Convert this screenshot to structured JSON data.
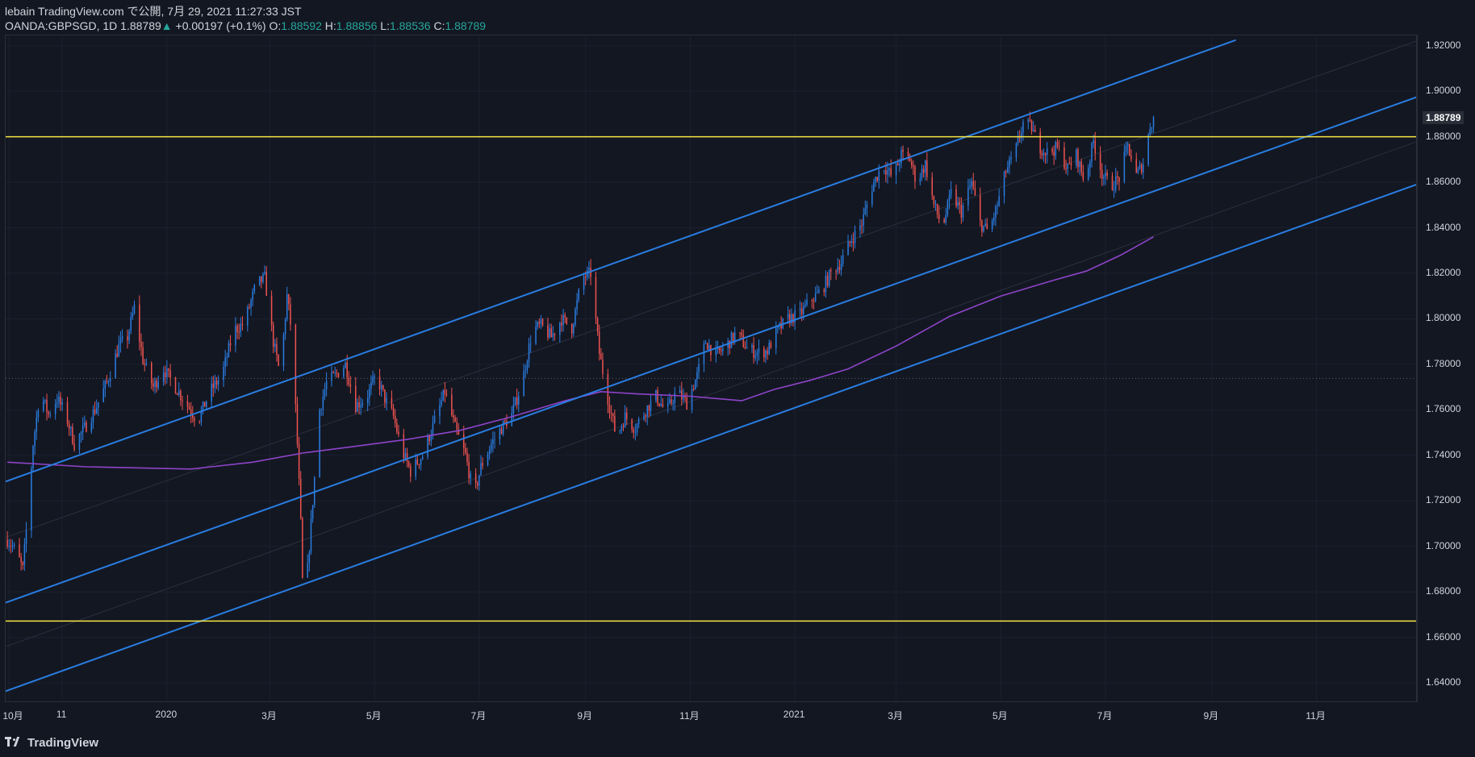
{
  "header": {
    "line1": "lebain TradingView.com で公開, 7月 29, 2021 11:27:33 JST",
    "symbol": "OANDA:GBPSGD, 1D",
    "last": "1.88789",
    "arrow": "▲",
    "change": "+0.00197 (+0.1%)",
    "o_label": "O:",
    "o_value": "1.88592",
    "h_label": "H:",
    "h_value": "1.88856",
    "l_label": "L:",
    "l_value": "1.88536",
    "c_label": "C:",
    "c_value": "1.88789"
  },
  "footer": {
    "brand": "TradingView"
  },
  "colors": {
    "bg": "#131722",
    "up": "#2a7de1",
    "down": "#ef5350",
    "channel": "#2a7de1",
    "hline": "#f5e642",
    "ma": "#8e44c9"
  },
  "chart_data": {
    "type": "candlestick",
    "symbol": "OANDA:GBPSGD",
    "timeframe": "1D",
    "y_ticks": [
      "1.92000",
      "1.90000",
      "1.88000",
      "1.86000",
      "1.84000",
      "1.82000",
      "1.80000",
      "1.78000",
      "1.76000",
      "1.74000",
      "1.72000",
      "1.70000",
      "1.68000",
      "1.66000",
      "1.64000"
    ],
    "y_tick_values": [
      1.92,
      1.9,
      1.88,
      1.86,
      1.84,
      1.82,
      1.8,
      1.78,
      1.76,
      1.74,
      1.72,
      1.7,
      1.68,
      1.66,
      1.64
    ],
    "ylim": [
      1.6312,
      1.9245
    ],
    "last_price_label": "1.88789",
    "last_price": 1.88789,
    "x_ticks": [
      {
        "label": "10月",
        "date": "2019-10-01"
      },
      {
        "label": "11",
        "date": "2019-11-01"
      },
      {
        "label": "2020",
        "date": "2020-01-01"
      },
      {
        "label": "3月",
        "date": "2020-03-01"
      },
      {
        "label": "5月",
        "date": "2020-05-01"
      },
      {
        "label": "7月",
        "date": "2020-07-01"
      },
      {
        "label": "9月",
        "date": "2020-09-01"
      },
      {
        "label": "11月",
        "date": "2020-11-01"
      },
      {
        "label": "2021",
        "date": "2021-01-01"
      },
      {
        "label": "3月",
        "date": "2021-03-01"
      },
      {
        "label": "5月",
        "date": "2021-05-01"
      },
      {
        "label": "7月",
        "date": "2021-07-01"
      },
      {
        "label": "9月",
        "date": "2021-09-01"
      },
      {
        "label": "11月",
        "date": "2021-11-01"
      }
    ],
    "xlim": [
      "2019-09-29",
      "2021-12-30"
    ],
    "price_path": [
      [
        "2019-09-30",
        1.703
      ],
      [
        "2019-10-05",
        1.698
      ],
      [
        "2019-10-09",
        1.69
      ],
      [
        "2019-10-12",
        1.715
      ],
      [
        "2019-10-15",
        1.745
      ],
      [
        "2019-10-19",
        1.768
      ],
      [
        "2019-10-24",
        1.758
      ],
      [
        "2019-10-29",
        1.765
      ],
      [
        "2019-11-03",
        1.758
      ],
      [
        "2019-11-08",
        1.745
      ],
      [
        "2019-11-14",
        1.752
      ],
      [
        "2019-11-20",
        1.76
      ],
      [
        "2019-11-27",
        1.772
      ],
      [
        "2019-12-04",
        1.788
      ],
      [
        "2019-12-09",
        1.792
      ],
      [
        "2019-12-13",
        1.805
      ],
      [
        "2019-12-18",
        1.782
      ],
      [
        "2019-12-24",
        1.77
      ],
      [
        "2019-12-30",
        1.778
      ],
      [
        "2020-01-06",
        1.77
      ],
      [
        "2020-01-13",
        1.762
      ],
      [
        "2020-01-19",
        1.755
      ],
      [
        "2020-01-26",
        1.768
      ],
      [
        "2020-02-02",
        1.775
      ],
      [
        "2020-02-09",
        1.795
      ],
      [
        "2020-02-15",
        1.798
      ],
      [
        "2020-02-22",
        1.815
      ],
      [
        "2020-02-27",
        1.818
      ],
      [
        "2020-03-03",
        1.79
      ],
      [
        "2020-03-07",
        1.775
      ],
      [
        "2020-03-11",
        1.81
      ],
      [
        "2020-03-14",
        1.792
      ],
      [
        "2020-03-17",
        1.745
      ],
      [
        "2020-03-19",
        1.71
      ],
      [
        "2020-03-20",
        1.685
      ],
      [
        "2020-03-23",
        1.69
      ],
      [
        "2020-03-26",
        1.72
      ],
      [
        "2020-03-30",
        1.76
      ],
      [
        "2020-04-03",
        1.772
      ],
      [
        "2020-04-08",
        1.775
      ],
      [
        "2020-04-14",
        1.78
      ],
      [
        "2020-04-20",
        1.762
      ],
      [
        "2020-04-26",
        1.765
      ],
      [
        "2020-05-02",
        1.775
      ],
      [
        "2020-05-07",
        1.765
      ],
      [
        "2020-05-12",
        1.757
      ],
      [
        "2020-05-17",
        1.742
      ],
      [
        "2020-05-22",
        1.733
      ],
      [
        "2020-05-29",
        1.74
      ],
      [
        "2020-06-05",
        1.755
      ],
      [
        "2020-06-11",
        1.768
      ],
      [
        "2020-06-17",
        1.752
      ],
      [
        "2020-06-23",
        1.74
      ],
      [
        "2020-06-28",
        1.722
      ],
      [
        "2020-07-02",
        1.735
      ],
      [
        "2020-07-08",
        1.745
      ],
      [
        "2020-07-14",
        1.752
      ],
      [
        "2020-07-20",
        1.758
      ],
      [
        "2020-07-26",
        1.772
      ],
      [
        "2020-08-01",
        1.795
      ],
      [
        "2020-08-06",
        1.797
      ],
      [
        "2020-08-12",
        1.792
      ],
      [
        "2020-08-18",
        1.8
      ],
      [
        "2020-08-24",
        1.796
      ],
      [
        "2020-08-30",
        1.818
      ],
      [
        "2020-09-04",
        1.82
      ],
      [
        "2020-09-09",
        1.785
      ],
      [
        "2020-09-14",
        1.765
      ],
      [
        "2020-09-19",
        1.748
      ],
      [
        "2020-09-24",
        1.757
      ],
      [
        "2020-09-30",
        1.752
      ],
      [
        "2020-10-06",
        1.76
      ],
      [
        "2020-10-12",
        1.766
      ],
      [
        "2020-10-18",
        1.759
      ],
      [
        "2020-10-24",
        1.768
      ],
      [
        "2020-10-30",
        1.763
      ],
      [
        "2020-11-05",
        1.775
      ],
      [
        "2020-11-10",
        1.79
      ],
      [
        "2020-11-16",
        1.784
      ],
      [
        "2020-11-22",
        1.788
      ],
      [
        "2020-11-28",
        1.794
      ],
      [
        "2020-12-04",
        1.787
      ],
      [
        "2020-12-10",
        1.785
      ],
      [
        "2020-12-16",
        1.786
      ],
      [
        "2020-12-22",
        1.795
      ],
      [
        "2020-12-28",
        1.8
      ],
      [
        "2021-01-04",
        1.802
      ],
      [
        "2021-01-10",
        1.808
      ],
      [
        "2021-01-16",
        1.812
      ],
      [
        "2021-01-22",
        1.82
      ],
      [
        "2021-01-28",
        1.825
      ],
      [
        "2021-02-03",
        1.835
      ],
      [
        "2021-02-09",
        1.842
      ],
      [
        "2021-02-15",
        1.858
      ],
      [
        "2021-02-21",
        1.868
      ],
      [
        "2021-02-27",
        1.862
      ],
      [
        "2021-03-04",
        1.872
      ],
      [
        "2021-03-09",
        1.87
      ],
      [
        "2021-03-13",
        1.86
      ],
      [
        "2021-03-18",
        1.868
      ],
      [
        "2021-03-23",
        1.85
      ],
      [
        "2021-03-28",
        1.84
      ],
      [
        "2021-04-02",
        1.855
      ],
      [
        "2021-04-08",
        1.847
      ],
      [
        "2021-04-14",
        1.86
      ],
      [
        "2021-04-19",
        1.842
      ],
      [
        "2021-04-24",
        1.838
      ],
      [
        "2021-04-29",
        1.85
      ],
      [
        "2021-05-04",
        1.865
      ],
      [
        "2021-05-09",
        1.872
      ],
      [
        "2021-05-14",
        1.886
      ],
      [
        "2021-05-19",
        1.884
      ],
      [
        "2021-05-23",
        1.876
      ],
      [
        "2021-05-28",
        1.873
      ],
      [
        "2021-06-03",
        1.875
      ],
      [
        "2021-06-09",
        1.866
      ],
      [
        "2021-06-14",
        1.872
      ],
      [
        "2021-06-19",
        1.86
      ],
      [
        "2021-06-24",
        1.878
      ],
      [
        "2021-06-29",
        1.864
      ],
      [
        "2021-07-04",
        1.858
      ],
      [
        "2021-07-09",
        1.862
      ],
      [
        "2021-07-14",
        1.876
      ],
      [
        "2021-07-19",
        1.863
      ],
      [
        "2021-07-24",
        1.87
      ],
      [
        "2021-07-27",
        1.885
      ],
      [
        "2021-07-29",
        1.888
      ]
    ],
    "moving_average": [
      [
        "2019-09-30",
        1.737
      ],
      [
        "2019-11-15",
        1.735
      ],
      [
        "2020-01-15",
        1.734
      ],
      [
        "2020-02-20",
        1.737
      ],
      [
        "2020-03-20",
        1.741
      ],
      [
        "2020-04-20",
        1.744
      ],
      [
        "2020-05-20",
        1.747
      ],
      [
        "2020-06-20",
        1.751
      ],
      [
        "2020-07-20",
        1.757
      ],
      [
        "2020-08-20",
        1.764
      ],
      [
        "2020-09-10",
        1.768
      ],
      [
        "2020-10-01",
        1.767
      ],
      [
        "2020-11-01",
        1.766
      ],
      [
        "2020-12-01",
        1.764
      ],
      [
        "2020-12-20",
        1.769
      ],
      [
        "2021-01-10",
        1.773
      ],
      [
        "2021-02-01",
        1.778
      ],
      [
        "2021-03-01",
        1.788
      ],
      [
        "2021-04-01",
        1.801
      ],
      [
        "2021-05-01",
        1.81
      ],
      [
        "2021-06-01",
        1.817
      ],
      [
        "2021-06-20",
        1.821
      ],
      [
        "2021-07-10",
        1.828
      ],
      [
        "2021-07-29",
        1.836
      ]
    ],
    "channel_lines": [
      {
        "name": "upper",
        "from": [
          "2019-09-29",
          1.7285
        ],
        "to": [
          "2021-09-15",
          1.9225
        ]
      },
      {
        "name": "middle",
        "from": [
          "2019-09-29",
          1.6753
        ],
        "to": [
          "2021-12-30",
          1.8976
        ]
      },
      {
        "name": "lower",
        "from": [
          "2019-09-29",
          1.6364
        ],
        "to": [
          "2021-12-30",
          1.8592
        ]
      }
    ],
    "channel_midlines": [
      {
        "from": [
          "2019-09-29",
          1.704
        ],
        "to": [
          "2021-12-30",
          1.9222
        ]
      },
      {
        "from": [
          "2019-09-29",
          1.656
        ],
        "to": [
          "2021-12-30",
          1.878
        ]
      }
    ],
    "horizontal_lines": [
      1.88,
      1.6672
    ],
    "dotted_price_line": 1.7738
  }
}
